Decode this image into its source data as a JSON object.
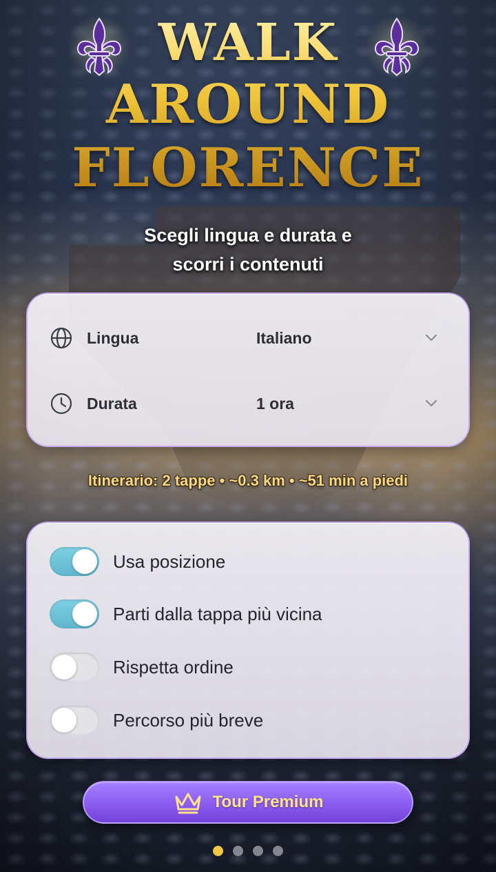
{
  "header": {
    "title_lines": [
      "WALK",
      "AROUND",
      "FLORENCE"
    ],
    "subtitle_lines": [
      "Scegli lingua e durata e",
      "scorri i contenuti"
    ]
  },
  "settings": {
    "language": {
      "label": "Lingua",
      "value": "Italiano",
      "icon": "globe-icon"
    },
    "duration": {
      "label": "Durata",
      "value": "1 ora",
      "icon": "clock-icon"
    }
  },
  "itinerary_info": "Itinerario: 2 tappe • ~0.3 km • ~51 min a piedi",
  "options": [
    {
      "label": "Usa posizione",
      "on": true
    },
    {
      "label": "Parti dalla tappa più vicina",
      "on": true
    },
    {
      "label": "Rispetta ordine",
      "on": false
    },
    {
      "label": "Percorso più breve",
      "on": false
    }
  ],
  "premium_button": {
    "label": "Tour Premium",
    "icon": "crown-icon"
  },
  "pagination": {
    "pages": 4,
    "current": 1
  },
  "colors": {
    "title_gold": "#e6b531",
    "accent_purple": "#8a5cf0",
    "toggle_on": "#6cc4d8",
    "dot_active": "#f2c744",
    "lily_purple": "#5b2d9a"
  }
}
